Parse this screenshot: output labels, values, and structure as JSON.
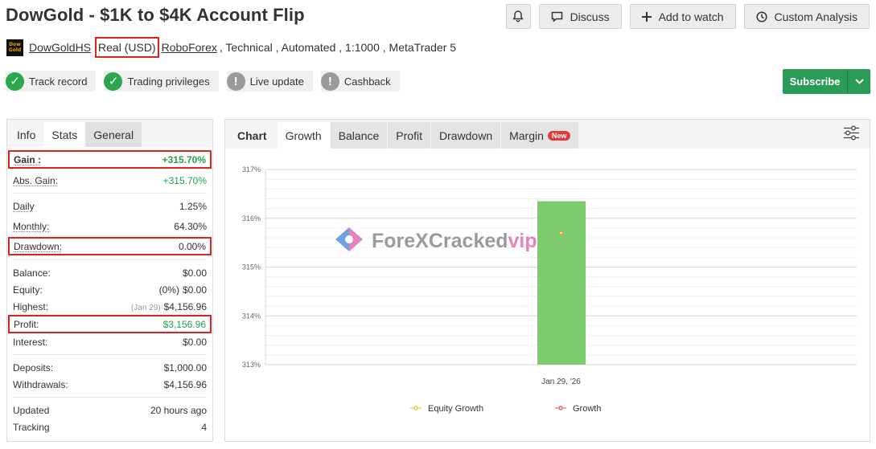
{
  "title": "DowGold - $1K to $4K Account Flip",
  "actions": {
    "discuss": "Discuss",
    "watch": "Add to watch",
    "custom": "Custom Analysis"
  },
  "meta": {
    "logo_line1": "Dow",
    "logo_line2": "Gold",
    "user": "DowGoldHS",
    "account": "Real (USD)",
    "broker": "RoboForex",
    "rest": ", Technical , Automated , 1:1000 , MetaTrader 5"
  },
  "badges": [
    {
      "label": "Track record",
      "status": "ok"
    },
    {
      "label": "Trading privileges",
      "status": "ok"
    },
    {
      "label": "Live update",
      "status": "warn"
    },
    {
      "label": "Cashback",
      "status": "warn"
    }
  ],
  "subscribe": "Subscribe",
  "left_tabs": [
    "Info",
    "Stats",
    "General"
  ],
  "stats": {
    "gain_label": "Gain :",
    "gain": "+315.70%",
    "abs_gain_label": "Abs. Gain:",
    "abs_gain": "+315.70%",
    "daily_label": "Daily",
    "daily": "1.25%",
    "monthly_label": "Monthly:",
    "monthly": "64.30%",
    "drawdown_label": "Drawdown:",
    "drawdown": "0.00%",
    "balance_label": "Balance:",
    "balance": "$0.00",
    "equity_label": "Equity:",
    "equity_sub": "(0%)",
    "equity": "$0.00",
    "highest_label": "Highest:",
    "highest_sub": "(Jan 29)",
    "highest": "$4,156.96",
    "profit_label": "Profit:",
    "profit": "$3,156.96",
    "interest_label": "Interest:",
    "interest": "$0.00",
    "deposits_label": "Deposits:",
    "deposits": "$1,000.00",
    "withdrawals_label": "Withdrawals:",
    "withdrawals": "$4,156.96",
    "updated_label": "Updated",
    "updated": "20 hours ago",
    "tracking_label": "Tracking",
    "tracking": "4"
  },
  "chart_tabs": {
    "label": "Chart",
    "growth": "Growth",
    "balance": "Balance",
    "profit": "Profit",
    "drawdown": "Drawdown",
    "margin": "Margin",
    "new": "New"
  },
  "watermark": {
    "main": "ForeXCracked",
    "accent": "vip"
  },
  "chart_data": {
    "type": "bar",
    "categories": [
      "Jan 29, '26"
    ],
    "series": [
      {
        "name": "Growth",
        "values": [
          316.35
        ],
        "color": "#7dcb6e"
      },
      {
        "name": "Equity Growth",
        "values": [
          315.7
        ],
        "color": "#f0a020"
      }
    ],
    "ylim": [
      313,
      317
    ],
    "yticks": [
      "313%",
      "314%",
      "315%",
      "316%",
      "317%"
    ],
    "yticks_values": [
      313,
      314,
      315,
      316,
      317
    ],
    "legend": [
      {
        "name": "Equity Growth",
        "color": "#f0c020"
      },
      {
        "name": "Growth",
        "color": "#e05050"
      }
    ],
    "grid": true,
    "legend_position": "bottom"
  }
}
